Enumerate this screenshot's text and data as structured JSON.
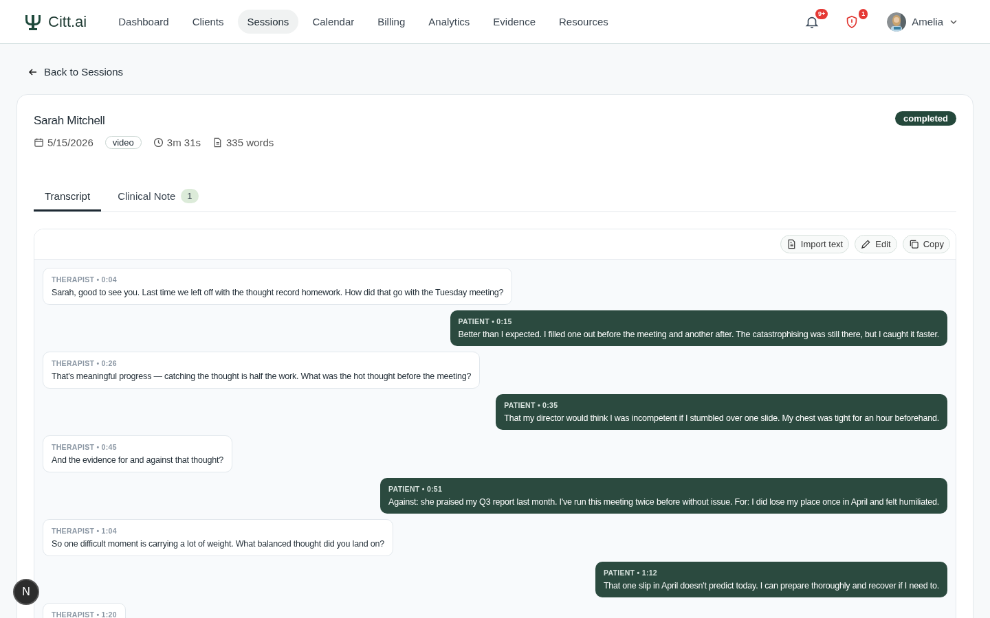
{
  "brand": {
    "name": "Citt.ai"
  },
  "nav": [
    {
      "label": "Dashboard",
      "selected": false
    },
    {
      "label": "Clients",
      "selected": false
    },
    {
      "label": "Sessions",
      "selected": true
    },
    {
      "label": "Calendar",
      "selected": false
    },
    {
      "label": "Billing",
      "selected": false
    },
    {
      "label": "Analytics",
      "selected": false
    },
    {
      "label": "Evidence",
      "selected": false
    },
    {
      "label": "Resources",
      "selected": false
    }
  ],
  "notifications": {
    "badge": "9+"
  },
  "alerts": {
    "badge": "1"
  },
  "user": {
    "name": "Amelia"
  },
  "back_link": "Back to Sessions",
  "session": {
    "client": "Sarah Mitchell",
    "status": "completed",
    "date": "5/15/2026",
    "mode": "video",
    "duration": "3m 31s",
    "words": "335 words"
  },
  "tabs": [
    {
      "label": "Transcript",
      "selected": true
    },
    {
      "label": "Clinical Note",
      "selected": false,
      "count": "1"
    }
  ],
  "toolbar": [
    "Import text",
    "Edit",
    "Copy"
  ],
  "messages": [
    {
      "kind": "therapist",
      "label": "THERAPIST • 0:04",
      "text": "Sarah, good to see you. Last time we left off with the thought record homework. How did that go with the Tuesday meeting?"
    },
    {
      "kind": "patient",
      "label": "PATIENT • 0:15",
      "text": "Better than I expected. I filled one out before the meeting and another after. The catastrophising was still there, but I caught it faster."
    },
    {
      "kind": "therapist",
      "label": "THERAPIST • 0:26",
      "text": "That's meaningful progress — catching the thought is half the work. What was the hot thought before the meeting?"
    },
    {
      "kind": "patient",
      "label": "PATIENT • 0:35",
      "text": "That my director would think I was incompetent if I stumbled over one slide. My chest was tight for an hour beforehand."
    },
    {
      "kind": "therapist",
      "label": "THERAPIST • 0:45",
      "text": "And the evidence for and against that thought?"
    },
    {
      "kind": "patient",
      "label": "PATIENT • 0:51",
      "text": "Against: she praised my Q3 report last month. I've run this meeting twice before without issue. For: I did lose my place once in April and felt humiliated."
    },
    {
      "kind": "therapist",
      "label": "THERAPIST • 1:04",
      "text": "So one difficult moment is carrying a lot of weight. What balanced thought did you land on?"
    },
    {
      "kind": "patient",
      "label": "PATIENT • 1:12",
      "text": "That one slip in April doesn't predict today. I can prepare thoroughly and recover if I need to."
    },
    {
      "kind": "therapist",
      "label": "THERAPIST • 1:20"
    }
  ],
  "floating_button": "N"
}
